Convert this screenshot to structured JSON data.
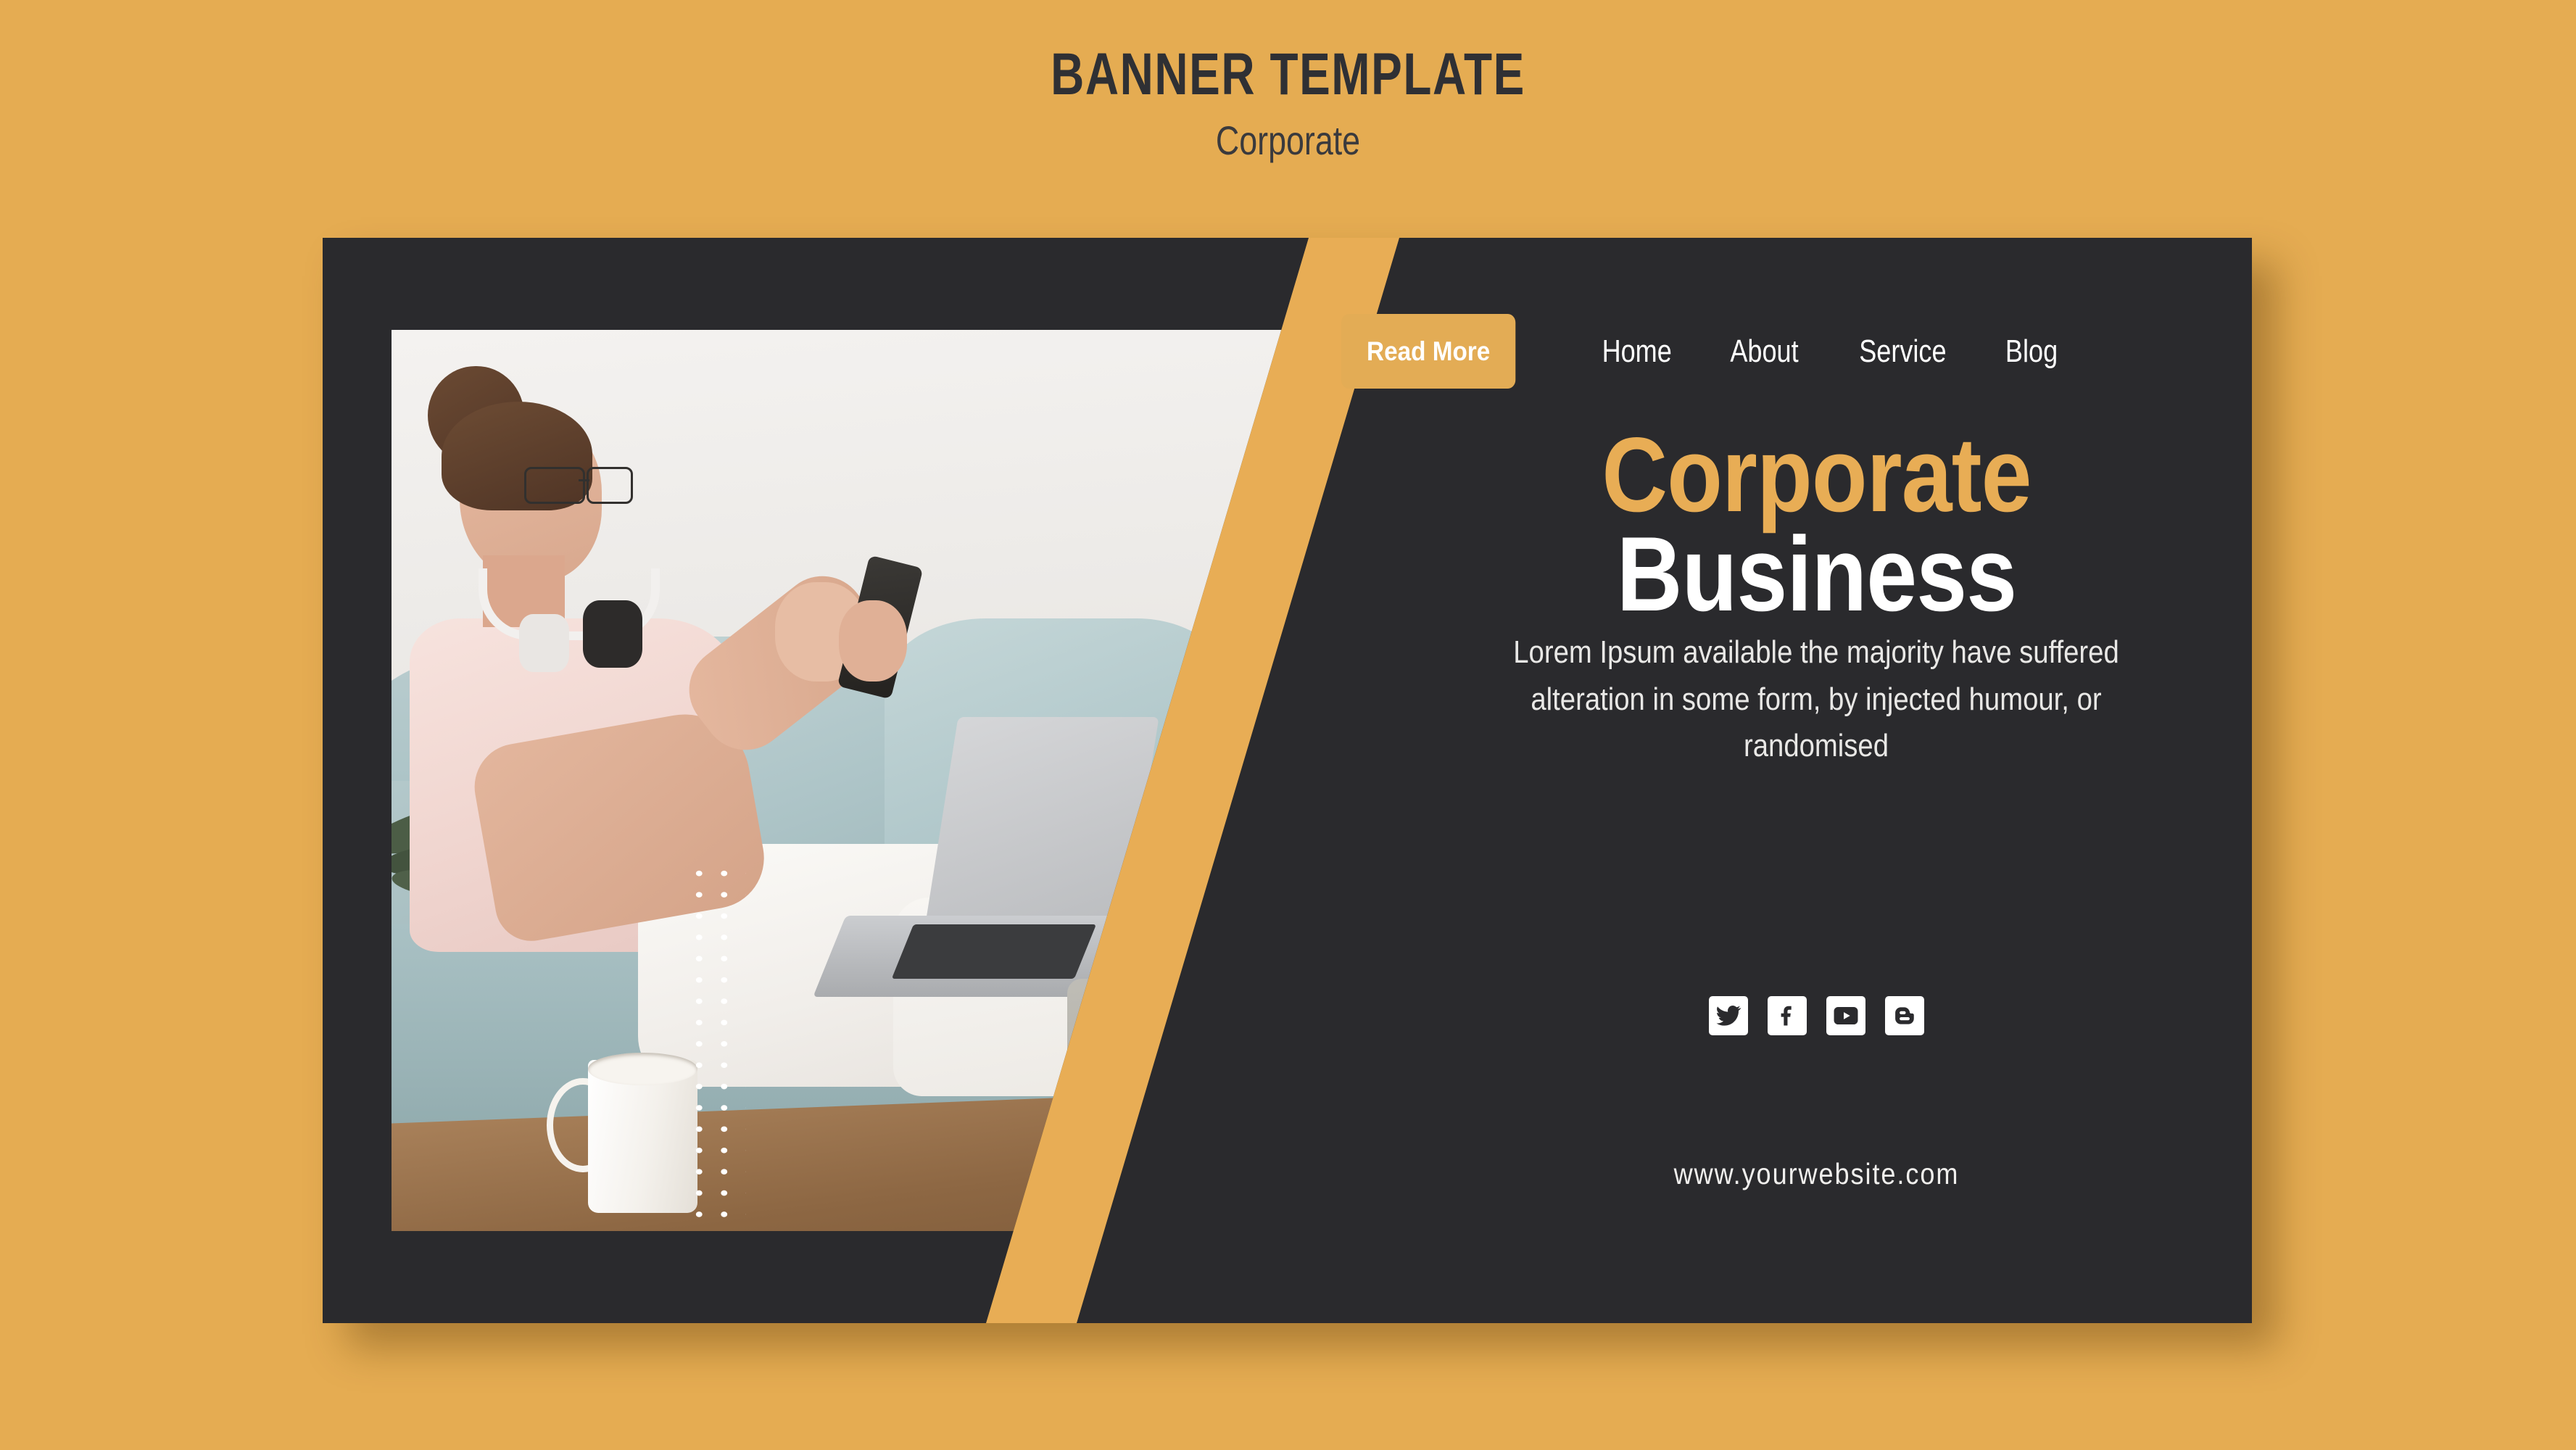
{
  "header": {
    "title": "BANNER TEMPLATE",
    "subtitle": "Corporate"
  },
  "card": {
    "nav": {
      "cta_label": "Read More",
      "links": [
        {
          "label": "Home"
        },
        {
          "label": "About"
        },
        {
          "label": "Service"
        },
        {
          "label": "Blog"
        }
      ]
    },
    "headline": {
      "line1": "Corporate",
      "line2": "Business"
    },
    "description": "Lorem Ipsum available the majority have suffered alteration in some form, by injected humour, or randomised",
    "social": [
      {
        "name": "twitter-icon"
      },
      {
        "name": "facebook-icon"
      },
      {
        "name": "youtube-icon"
      },
      {
        "name": "blogger-icon"
      }
    ],
    "website": "www.yourwebsite.com",
    "photo_alt": "Woman in glasses with headphones relaxing on a teal sofa using a smartphone with a laptop on her lap and a white mug on a wooden table"
  },
  "colors": {
    "background_amber": "#e5ac52",
    "card_dark": "#2a2a2d",
    "accent_amber": "#e8ad55",
    "button_amber": "#e3ac55",
    "text_white": "#ffffff",
    "title_dark": "#2f3034"
  }
}
